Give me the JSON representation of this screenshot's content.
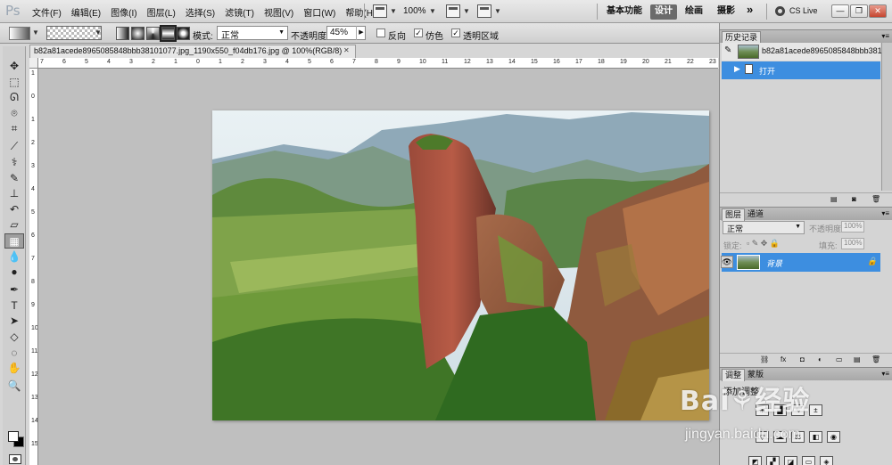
{
  "app": {
    "logo": "Ps"
  },
  "menubar": {
    "menus": [
      "文件(F)",
      "编辑(E)",
      "图像(I)",
      "图层(L)",
      "选择(S)",
      "滤镜(T)",
      "视图(V)",
      "窗口(W)",
      "帮助(H)"
    ],
    "zoom": "100%",
    "workspaces": [
      "基本功能",
      "设计",
      "绘画",
      "摄影"
    ],
    "active_workspace": "设计",
    "more": "»",
    "cs_live": "CS Live",
    "window_buttons": [
      "—",
      "❐",
      "✕"
    ]
  },
  "options": {
    "mode_label": "模式:",
    "mode_value": "正常",
    "opacity_label": "不透明度:",
    "opacity_value": "45%",
    "reverse_label": "反向",
    "reverse_checked": false,
    "dither_label": "仿色",
    "dither_checked": true,
    "transparency_label": "透明区域",
    "transparency_checked": true,
    "check_mark": "✓"
  },
  "tools": [
    {
      "name": "move-tool",
      "glyph": "✥"
    },
    {
      "name": "marquee-tool",
      "glyph": "⬚"
    },
    {
      "name": "lasso-tool",
      "glyph": "ᘏ"
    },
    {
      "name": "quick-select-tool",
      "glyph": "⌾"
    },
    {
      "name": "crop-tool",
      "glyph": "⌗"
    },
    {
      "name": "eyedropper-tool",
      "glyph": "⟋"
    },
    {
      "name": "healing-brush-tool",
      "glyph": "⚕"
    },
    {
      "name": "brush-tool",
      "glyph": "✎"
    },
    {
      "name": "clone-stamp-tool",
      "glyph": "⊥"
    },
    {
      "name": "history-brush-tool",
      "glyph": "↶"
    },
    {
      "name": "eraser-tool",
      "glyph": "▱"
    },
    {
      "name": "gradient-tool",
      "glyph": "▦"
    },
    {
      "name": "blur-tool",
      "glyph": "💧"
    },
    {
      "name": "dodge-tool",
      "glyph": "●"
    },
    {
      "name": "pen-tool",
      "glyph": "✒"
    },
    {
      "name": "type-tool",
      "glyph": "T"
    },
    {
      "name": "path-select-tool",
      "glyph": "➤"
    },
    {
      "name": "shape-tool",
      "glyph": "◇"
    },
    {
      "name": "3d-rotate-tool",
      "glyph": "◌"
    },
    {
      "name": "hand-tool",
      "glyph": "✋"
    },
    {
      "name": "zoom-tool",
      "glyph": "🔍"
    }
  ],
  "document": {
    "tab_title": "b82a81acede8965085848bbb38101077.jpg_1190x550_f04db176.jpg @ 100%(RGB/8)",
    "tab_close": "✕",
    "ruler_h": [
      "7",
      "6",
      "5",
      "4",
      "3",
      "2",
      "1",
      "0",
      "1",
      "2",
      "3",
      "4",
      "5",
      "6",
      "7",
      "8",
      "9",
      "10",
      "11",
      "12",
      "13",
      "14",
      "15",
      "16",
      "17",
      "18",
      "19",
      "20",
      "21",
      "22",
      "23"
    ],
    "ruler_v": [
      "1",
      "0",
      "1",
      "2",
      "3",
      "4",
      "5",
      "6",
      "7",
      "8",
      "9",
      "10",
      "11",
      "12",
      "13",
      "14",
      "15"
    ]
  },
  "history": {
    "tabs": [
      "历史记录"
    ],
    "snapshot_label": "b82a81acede8965085848bbb381...",
    "open_label": "打开"
  },
  "layers": {
    "tabs": [
      "图层",
      "通道"
    ],
    "blend": "正常",
    "opacity_label": "不透明度:",
    "opacity_value": "100%",
    "lock_label": "锁定:",
    "fill_label": "填充:",
    "fill_value": "100%",
    "layer_name": "背景",
    "eye_icon": "👁",
    "lock_icon": "🔒"
  },
  "adjustments": {
    "tabs": [
      "调整",
      "蒙版"
    ],
    "add_label": "添加调整"
  },
  "watermark": {
    "main": "Bai⚘经验",
    "sub": "jingyan.baidu.com"
  }
}
